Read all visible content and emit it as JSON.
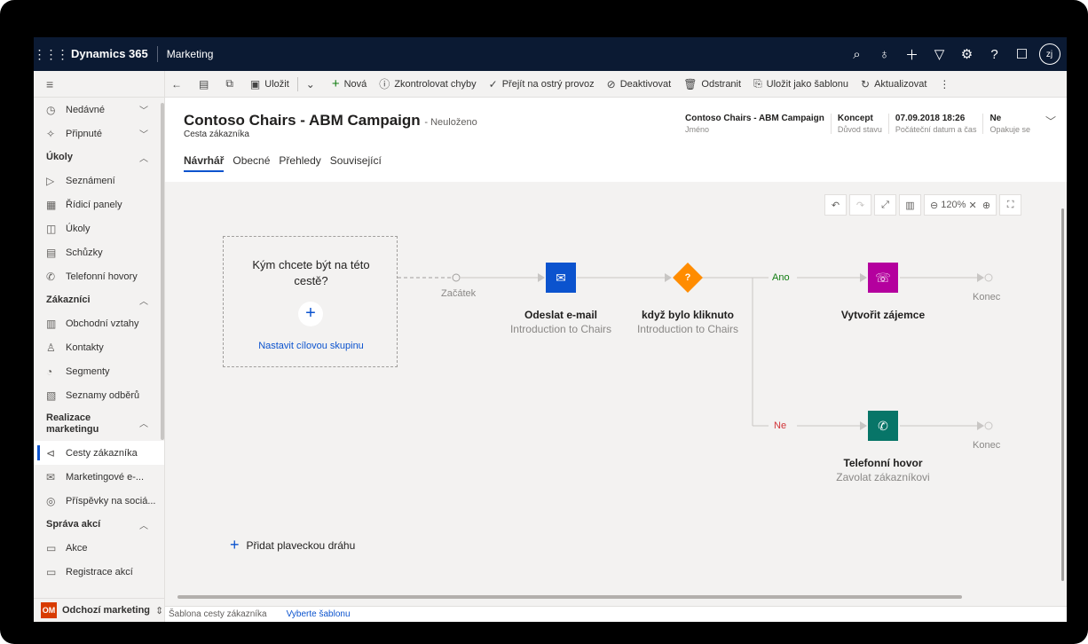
{
  "topbar": {
    "brand": "Dynamics 365",
    "app": "Marketing",
    "avatar": "zj",
    "icons": [
      "search-icon",
      "lightbulb-icon",
      "plus-icon",
      "filter-icon",
      "gear-icon",
      "help-icon",
      "chat-icon"
    ]
  },
  "commands": {
    "save": "Uložit",
    "new": "Nová",
    "check_errors": "Zkontrolovat chyby",
    "go_live": "Přejít na ostrý provoz",
    "deactivate": "Deaktivovat",
    "delete": "Odstranit",
    "save_template": "Uložit jako šablonu",
    "refresh": "Aktualizovat"
  },
  "sidebar": {
    "recent": "Nedávné",
    "pinned": "Připnuté",
    "groups": [
      {
        "label": "Úkoly",
        "items": [
          "Seznámení",
          "Řídicí panely",
          "Úkoly",
          "Schůzky",
          "Telefonní hovory"
        ]
      },
      {
        "label": "Zákazníci",
        "items": [
          "Obchodní vztahy",
          "Kontakty",
          "Segmenty",
          "Seznamy odběrů"
        ]
      },
      {
        "label": "Realizace marketingu",
        "items": [
          "Cesty zákazníka",
          "Marketingové e-...",
          "Příspěvky na sociá..."
        ]
      },
      {
        "label": "Správa akcí",
        "items": [
          "Akce",
          "Registrace akcí"
        ]
      }
    ],
    "area_badge": "OM",
    "area": "Odchozí marketing"
  },
  "header": {
    "title": "Contoso Chairs - ABM Campaign",
    "unsaved": "- Neuloženo",
    "entity": "Cesta zákazníka",
    "fields": [
      {
        "value": "Contoso Chairs - ABM Campaign",
        "label": "Jméno"
      },
      {
        "value": "Koncept",
        "label": "Důvod stavu"
      },
      {
        "value": "07.09.2018 18:26",
        "label": "Počáteční datum a čas"
      },
      {
        "value": "Ne",
        "label": "Opakuje se"
      }
    ]
  },
  "tabs": [
    "Návrhář",
    "Obecné",
    "Přehledy",
    "Související"
  ],
  "canvas": {
    "zoom": "120%",
    "target_question": "Kým chcete být na této cestě?",
    "target_link": "Nastavit cílovou skupinu",
    "start": "Začátek",
    "nodes": [
      {
        "title": "Odeslat e-mail",
        "subtitle": "Introduction to Chairs",
        "color": "#0b53ce"
      },
      {
        "title": "když bylo kliknuto",
        "subtitle": "Introduction to Chairs",
        "color": "#ff8c00"
      },
      {
        "title": "Vytvořit zájemce",
        "subtitle": "",
        "color": "#b4009e"
      },
      {
        "title": "Telefonní hovor",
        "subtitle": "Zavolat zákazníkovi",
        "color": "#077568"
      }
    ],
    "branch_yes": "Ano",
    "branch_no": "Ne",
    "end": "Konec",
    "add_lane": "Přidat plaveckou dráhu"
  },
  "footer": {
    "template_label": "Šablona cesty zákazníka",
    "template_link": "Vyberte šablonu"
  }
}
